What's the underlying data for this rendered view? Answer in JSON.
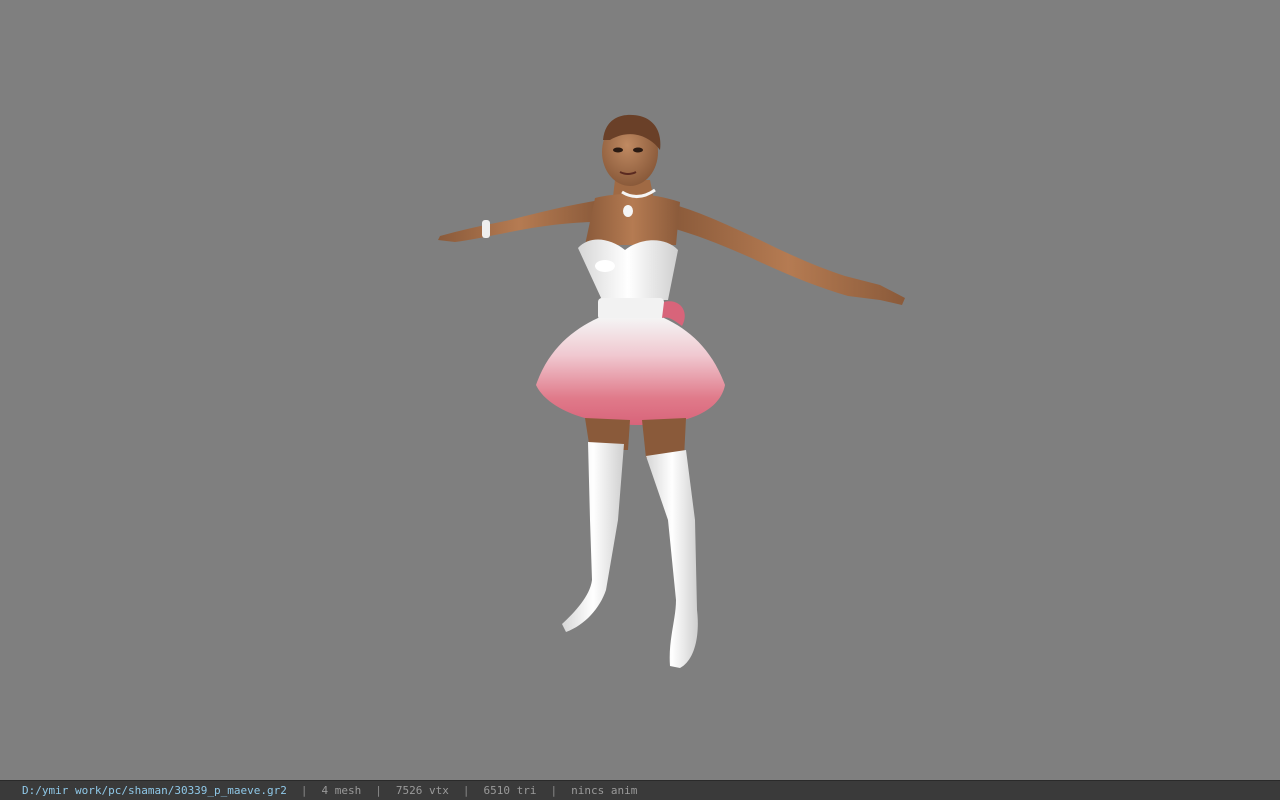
{
  "viewport": {
    "background": "#7f7f7f",
    "model_name": "30339_p_maeve"
  },
  "status": {
    "file_path": "D:/ymir work/pc/shaman/30339_p_maeve.gr2",
    "mesh_count": "4 mesh",
    "vertex_count": "7526 vtx",
    "triangle_count": "6510 tri",
    "anim_status": "nincs anim",
    "separator": "|",
    "path_color": "#8fc8e8",
    "bar_color": "#3a3a3a"
  }
}
